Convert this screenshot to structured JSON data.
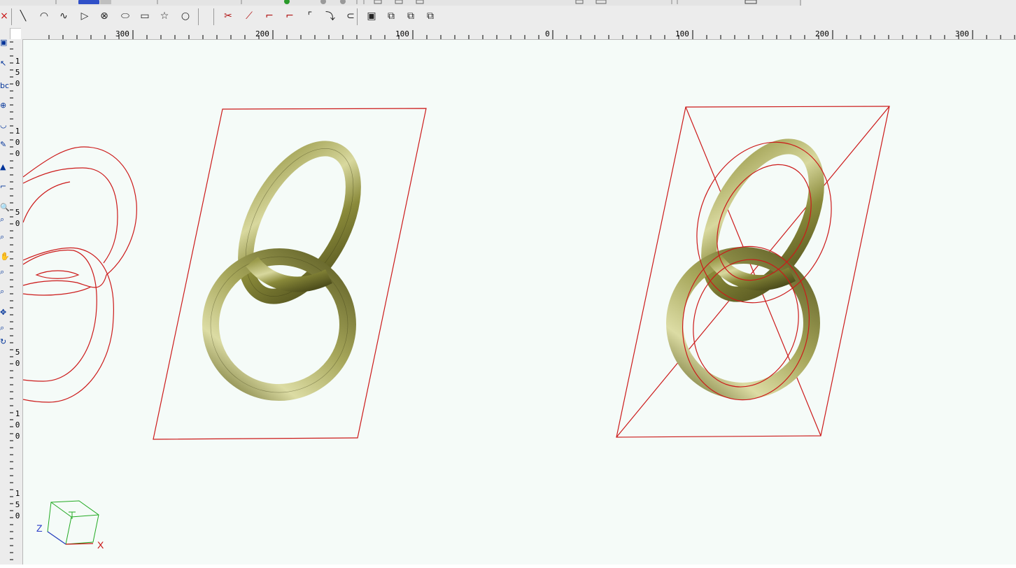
{
  "ruler": {
    "top_labels": [
      "300",
      "200",
      "100",
      "0",
      "100",
      "200",
      "300"
    ],
    "left_labels": [
      [
        "1",
        "5",
        "0"
      ],
      [
        "1",
        "0",
        "0"
      ],
      [
        "5",
        "0"
      ],
      [
        "5",
        "0"
      ],
      [
        "1",
        "0",
        "0"
      ],
      [
        "1",
        "5",
        "0"
      ]
    ]
  },
  "toolbar": {
    "tools": [
      {
        "name": "line-icon",
        "glyph": "╲"
      },
      {
        "name": "arc-center-icon",
        "glyph": "◠"
      },
      {
        "name": "spline-icon",
        "glyph": "∿"
      },
      {
        "name": "polyline-icon",
        "glyph": "▷"
      },
      {
        "name": "circle-point-icon",
        "glyph": "⊗"
      },
      {
        "name": "ellipse-icon",
        "glyph": "⬭"
      },
      {
        "name": "rectangle-icon",
        "glyph": "▭"
      },
      {
        "name": "star-icon",
        "glyph": "☆"
      },
      {
        "name": "polygon-icon",
        "glyph": "○"
      },
      {
        "name": "trim-icon",
        "glyph": "✂"
      },
      {
        "name": "extend-icon",
        "glyph": "⟋"
      },
      {
        "name": "fillet-icon",
        "glyph": "⌐"
      },
      {
        "name": "chamfer-icon",
        "glyph": "⌐"
      },
      {
        "name": "corner-icon",
        "glyph": "⌜"
      },
      {
        "name": "blend-curve-icon",
        "glyph": "⤵"
      },
      {
        "name": "slot-icon",
        "glyph": "⊂"
      },
      {
        "name": "offset-icon",
        "glyph": "▣"
      },
      {
        "name": "array-icon",
        "glyph": "⧉"
      },
      {
        "name": "array-copy-icon",
        "glyph": "⧉"
      },
      {
        "name": "array-move-icon",
        "glyph": "⧉"
      }
    ]
  },
  "left_tools": [
    {
      "name": "select-icon",
      "glyph": "▣"
    },
    {
      "name": "pick-icon",
      "glyph": "↖"
    },
    {
      "name": "text-abc-icon",
      "glyph": "bc"
    },
    {
      "name": "sphere-icon",
      "glyph": "⊕"
    },
    {
      "name": "curve-icon",
      "glyph": "◡"
    },
    {
      "name": "pen-icon",
      "glyph": "✎"
    },
    {
      "name": "fill-icon",
      "glyph": "▲"
    },
    {
      "name": "measure-icon",
      "glyph": "⌐"
    },
    {
      "name": "zoom-icon",
      "glyph": "🔍"
    },
    {
      "name": "zoom-window-icon",
      "glyph": "⌕"
    },
    {
      "name": "zoom-in-icon",
      "glyph": "⌕"
    },
    {
      "name": "pan-icon",
      "glyph": "✋"
    },
    {
      "name": "zoom-out-icon",
      "glyph": "⌕"
    },
    {
      "name": "zoom-all-icon",
      "glyph": "⌕"
    },
    {
      "name": "move-icon",
      "glyph": "✥"
    },
    {
      "name": "magnify-icon",
      "glyph": "⌕"
    },
    {
      "name": "rotate-icon",
      "glyph": "↻"
    }
  ],
  "viewport": {
    "axis_z": "Z",
    "axis_x": "X",
    "colors": {
      "background": "#f5fbf8",
      "wire": "#cc1a1a",
      "ring_gold": "#8c8c3c",
      "ring_light": "#d6d69a",
      "ring_dark": "#4e4e1c",
      "axis_cube": "#22aa22",
      "axis_z_color": "#2a3cc8",
      "axis_x_color": "#c81010"
    }
  }
}
